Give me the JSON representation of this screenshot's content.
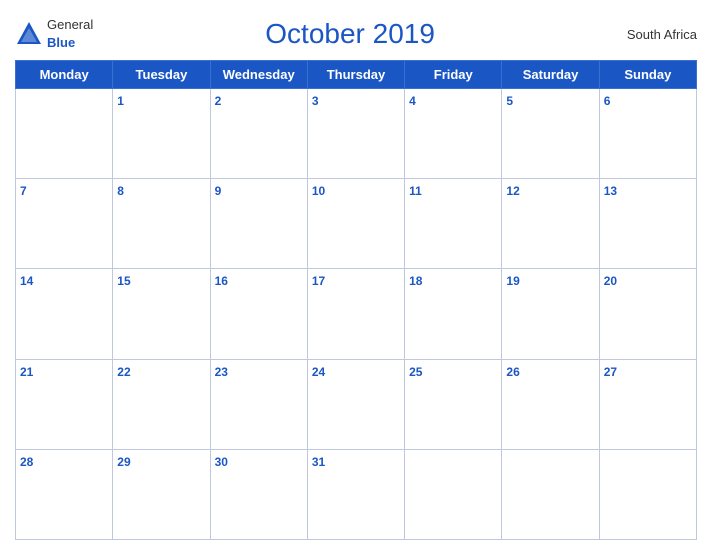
{
  "header": {
    "logo_general": "General",
    "logo_blue": "Blue",
    "title": "October 2019",
    "country": "South Africa"
  },
  "weekdays": [
    "Monday",
    "Tuesday",
    "Wednesday",
    "Thursday",
    "Friday",
    "Saturday",
    "Sunday"
  ],
  "weeks": [
    [
      null,
      1,
      2,
      3,
      4,
      5,
      6
    ],
    [
      7,
      8,
      9,
      10,
      11,
      12,
      13
    ],
    [
      14,
      15,
      16,
      17,
      18,
      19,
      20
    ],
    [
      21,
      22,
      23,
      24,
      25,
      26,
      27
    ],
    [
      28,
      29,
      30,
      31,
      null,
      null,
      null
    ]
  ]
}
